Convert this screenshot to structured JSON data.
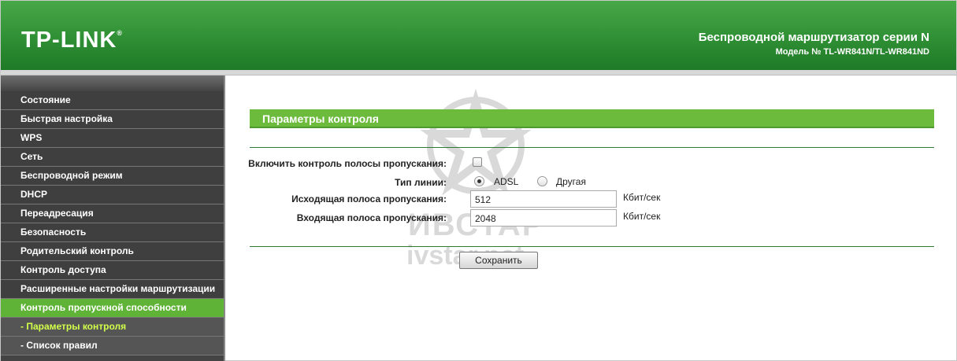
{
  "header": {
    "logo": "TP-LINK",
    "logo_mark": "®",
    "product": "Беспроводной маршрутизатор серии N",
    "model": "Модель № TL-WR841N/TL-WR841ND"
  },
  "sidebar": {
    "items": [
      {
        "label": "Состояние"
      },
      {
        "label": "Быстрая настройка"
      },
      {
        "label": "WPS"
      },
      {
        "label": "Сеть"
      },
      {
        "label": "Беспроводной режим"
      },
      {
        "label": "DHCP"
      },
      {
        "label": "Переадресация"
      },
      {
        "label": "Безопасность"
      },
      {
        "label": "Родительский контроль"
      },
      {
        "label": "Контроль доступа"
      },
      {
        "label": "Расширенные настройки маршрутизации"
      },
      {
        "label": "Контроль пропускной способности"
      },
      {
        "label": "- Параметры контроля"
      },
      {
        "label": "- Список правил"
      }
    ]
  },
  "main": {
    "title": "Параметры контроля",
    "enable_label": "Включить контроль полосы пропускания:",
    "line_type_label": "Тип линии:",
    "line_options": [
      "ADSL",
      "Другая"
    ],
    "line_selected": "ADSL",
    "upload_label": "Исходящая полоса пропускания:",
    "upload_value": "512",
    "download_label": "Входящая полоса пропускания:",
    "download_value": "2048",
    "unit": "Кбит/сек",
    "save_label": "Сохранить"
  },
  "watermark": {
    "text1": "ИВСТАР",
    "text2": "ivstar.net"
  }
}
